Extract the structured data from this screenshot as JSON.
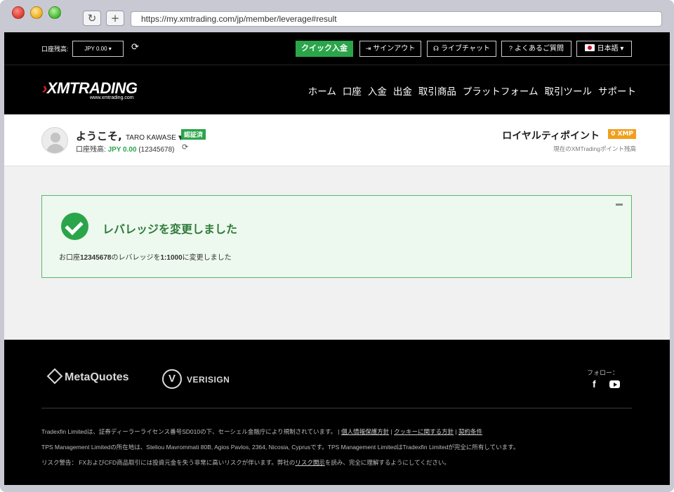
{
  "browser": {
    "url": "https://my.xmtrading.com/jp/member/leverage#result",
    "reload_icon": "↻",
    "newtab_icon": "+"
  },
  "topbar": {
    "balance_label": "口座残高:",
    "balance_value": "JPY 0.00",
    "quick_deposit": "クイック入金",
    "signout": "サインアウト",
    "livechat": "ライブチャット",
    "faq": "よくあるご質問",
    "language": "日本語"
  },
  "nav": {
    "logo": "XMTRADING",
    "logo_sub": "www.xmtrading.com",
    "items": [
      "ホーム",
      "口座",
      "入金",
      "出金",
      "取引商品",
      "プラットフォーム",
      "取引ツール",
      "サポート"
    ]
  },
  "welcome": {
    "greeting": "ようこそ,",
    "name": "TARO KAWASE",
    "verified": "認証済",
    "balance_label": "口座残高:",
    "balance_value": "JPY 0.00",
    "account": "(12345678)",
    "points_title": "ロイヤルティポイント",
    "points_badge": "0 XMP",
    "points_sub": "現在のXMTradingポイント残高"
  },
  "result": {
    "title": "レバレッジを変更しました",
    "msg_prefix": "お口座",
    "account": "12345678",
    "msg_mid": "のレバレッジを",
    "leverage": "1:1000",
    "msg_suffix": "に変更しました"
  },
  "footer": {
    "metaquotes": "MetaQuotes",
    "verisign": "VERISIGN",
    "verisign_mark": "V",
    "follow": "フォロー：",
    "facebook": "f",
    "legal1_text": "Tradexfin Limitedは、証券ディーラーライセンス番号SD010の下、セーシェル金融庁により規制されています。 | ",
    "privacy": "個人情報保護方針",
    "sep": " | ",
    "cookie": "クッキーに関する方針",
    "terms": "契約条件",
    "legal2": "TPS Management Limitedの所在地は、Steliou Mavrommati 80B, Agios Pavlos, 2364, Nicosia, Cyprusです。TPS Management LimitedはTradexfin Limitedが完全に所有しています。",
    "legal3_pre": "リスク警告： FXおよびCFD商品取引には投資元金を失う非常に高いリスクが伴います。弊社の",
    "risk_link": "リスク開示",
    "legal3_post": "を読み、完全に理解するようにしてください。"
  }
}
